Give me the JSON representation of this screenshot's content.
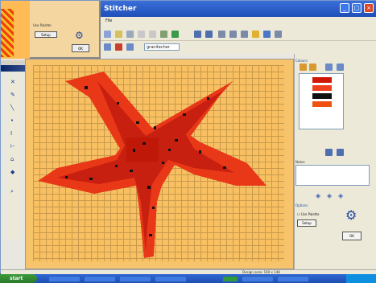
{
  "app": {
    "title": "Stitcher",
    "menu_first": "File"
  },
  "toolbar": {
    "palette_dropdown": "granitecher"
  },
  "inset": {
    "option_label": "Use Palette",
    "button_label": "Setup",
    "ok_label": "OK"
  },
  "right_panel": {
    "threads_title": "Colours",
    "notes_title": "Notes",
    "options_title": "Options",
    "checkbox_label": "Use Palette",
    "setup_label": "Setup",
    "ok_label": "OK",
    "swatches": [
      "#d01808",
      "#f04020",
      "#101010",
      "#f05010"
    ]
  },
  "status": {
    "text": "Design area: 160 x 148"
  },
  "taskbar": {
    "start_label": "start"
  },
  "colors": {
    "background": "#f8c060",
    "starfish_dark": "#c82010",
    "starfish_light": "#e83818",
    "accent": "#1f4fb8"
  }
}
